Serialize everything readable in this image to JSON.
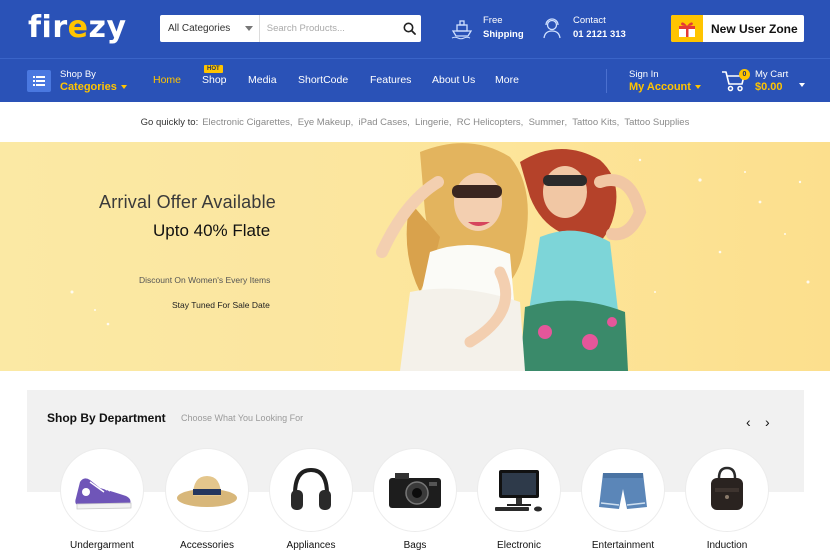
{
  "brand": {
    "logo_text_a": "fir",
    "logo_text_b": "e",
    "logo_text_c": "zy"
  },
  "search": {
    "category": "All Categories",
    "placeholder": "Search Products..."
  },
  "header_info": [
    {
      "icon": "ship-icon",
      "line1": "Free",
      "line2": "Shipping"
    },
    {
      "icon": "support-agent-icon",
      "line1": "Contact",
      "line2": "01 2121 313"
    }
  ],
  "new_user_zone": {
    "label": "New User Zone",
    "icon": "gift-icon"
  },
  "nav": {
    "shop_by": "Shop By",
    "categories": "Categories",
    "links": [
      {
        "label": "Home",
        "active": true
      },
      {
        "label": "Shop",
        "badge": "HOT"
      },
      {
        "label": "Media"
      },
      {
        "label": "ShortCode"
      },
      {
        "label": "Features"
      },
      {
        "label": "About Us"
      },
      {
        "label": "More"
      }
    ],
    "sign_in": "Sign In",
    "my_account": "My Account",
    "cart_label": "My Cart",
    "cart_total": "$0.00",
    "cart_count": "0"
  },
  "quick_links": {
    "label": "Go quickly to:",
    "items": [
      "Electronic Cigarettes",
      "Eye Makeup",
      "iPad Cases",
      "Lingerie",
      "RC Helicopters",
      "Summer",
      "Tattoo Kits",
      "Tattoo Supplies"
    ]
  },
  "hero": {
    "headline": "Arrival Offer Available",
    "offer": "Upto 40% Flate",
    "caption": "Discount On Women's Every Items",
    "cta": "Stay Tuned For Sale Date"
  },
  "department": {
    "title": "Shop By Department",
    "subtitle": "Choose What You Looking For",
    "prev": "‹",
    "next": "›",
    "items": [
      {
        "name": "Undergarment",
        "icon": "sneaker-icon"
      },
      {
        "name": "Accessories",
        "icon": "hat-icon"
      },
      {
        "name": "Appliances",
        "icon": "headphones-icon"
      },
      {
        "name": "Bags",
        "icon": "camera-icon"
      },
      {
        "name": "Electronic",
        "icon": "computer-icon"
      },
      {
        "name": "Entertainment",
        "icon": "shorts-icon"
      },
      {
        "name": "Induction",
        "icon": "bag-icon"
      }
    ]
  },
  "colors": {
    "primary": "#2a52b7",
    "accent": "#ffc400",
    "banner": "#fbe7a1",
    "panel": "#f1f1f1"
  }
}
